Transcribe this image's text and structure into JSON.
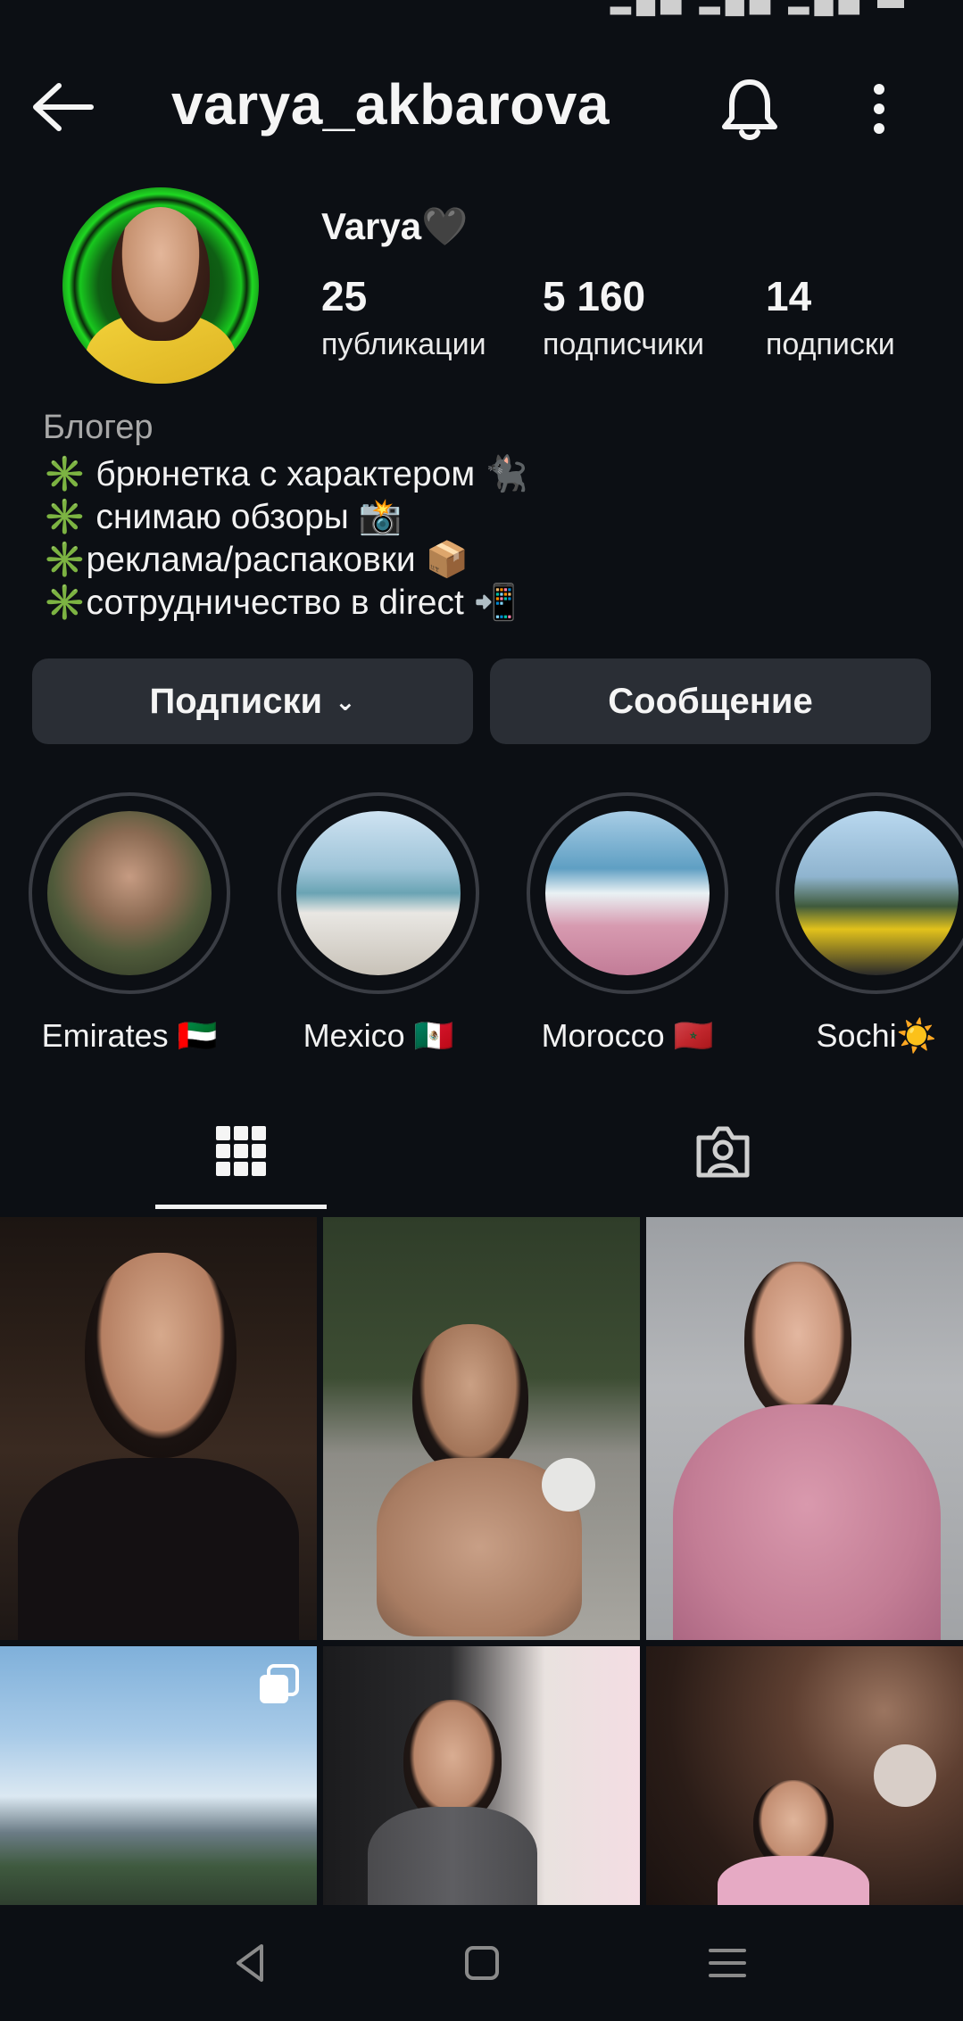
{
  "header": {
    "username": "varya_akbarova"
  },
  "profile": {
    "display_name": "Varya🖤",
    "stats": [
      {
        "value": "25",
        "label": "публикации"
      },
      {
        "value": "5 160",
        "label": "подписчики"
      },
      {
        "value": "14",
        "label": "подписки"
      }
    ],
    "category": "Блогер",
    "bio": [
      "✳️ брюнетка с характером 🐈‍⬛",
      "✳️ снимаю обзоры 📸",
      "✳️реклама/распаковки 📦",
      "✳️сотрудничество в direct 📲"
    ]
  },
  "actions": {
    "following_label": "Подписки",
    "message_label": "Сообщение"
  },
  "highlights": [
    {
      "label": "Emirates 🇦🇪"
    },
    {
      "label": "Mexico 🇲🇽"
    },
    {
      "label": "Morocco 🇲🇦"
    },
    {
      "label": "Sochi☀️"
    }
  ],
  "tabs": [
    {
      "icon": "grid-icon",
      "active": true
    },
    {
      "icon": "tagged-icon",
      "active": false
    }
  ],
  "navbar": {
    "icons": [
      "back-triangle-icon",
      "home-square-icon",
      "menu-lines-icon"
    ]
  },
  "colors": {
    "background": "#0c0f14",
    "button": "#2a2e35",
    "text": "#f5f5f5",
    "muted": "#a8a8a8"
  }
}
